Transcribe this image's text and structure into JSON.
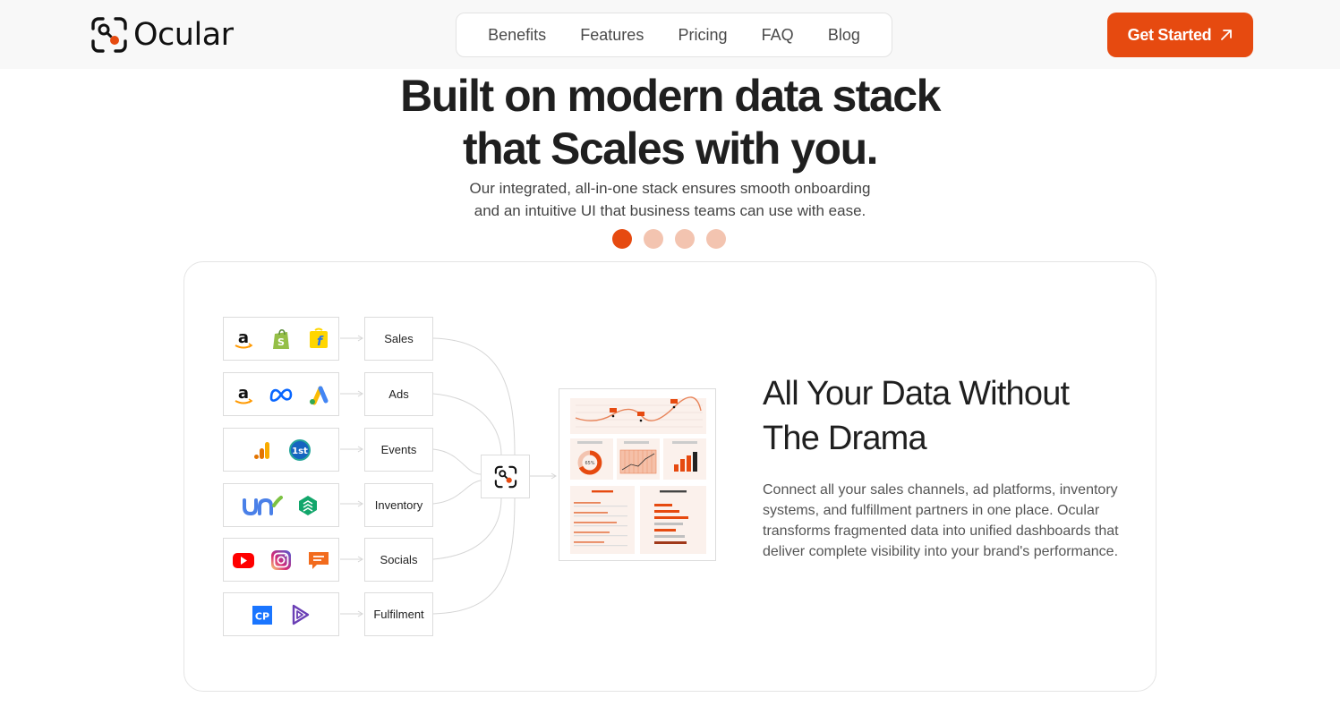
{
  "header": {
    "logo_text": "Ocular",
    "nav": [
      "Benefits",
      "Features",
      "Pricing",
      "FAQ",
      "Blog"
    ],
    "cta_label": "Get Started"
  },
  "hero": {
    "title_line1": "Built on modern data stack",
    "title_line2": "that Scales with you.",
    "subtitle_line1": "Our integrated, all-in-one stack ensures smooth onboarding",
    "subtitle_line2": "and an intuitive UI that business teams can use with ease.",
    "carousel": {
      "total": 4,
      "active_index": 0
    }
  },
  "diagram": {
    "rows": [
      {
        "category": "Sales",
        "icons": [
          "amazon-icon",
          "shopify-icon",
          "flipkart-icon"
        ]
      },
      {
        "category": "Ads",
        "icons": [
          "amazon-icon",
          "meta-icon",
          "google-ads-icon"
        ]
      },
      {
        "category": "Events",
        "icons": [
          "google-analytics-icon",
          "first-party-icon"
        ]
      },
      {
        "category": "Inventory",
        "icons": [
          "unicommerce-icon",
          "easyecom-icon"
        ]
      },
      {
        "category": "Socials",
        "icons": [
          "youtube-icon",
          "instagram-icon",
          "chat-icon"
        ]
      },
      {
        "category": "Fulfilment",
        "icons": [
          "clickpost-icon",
          "shiprocket-icon"
        ]
      }
    ],
    "dashboard": {
      "donut_label": "65%"
    }
  },
  "feature": {
    "title_line1": "All Your Data Without",
    "title_line2": "The Drama",
    "body": "Connect all your sales channels, ad platforms, inventory systems, and fulfillment partners in one place. Ocular transforms fragmented data into unified dashboards that deliver complete visibility into your brand's performance."
  },
  "colors": {
    "accent": "#e64a10",
    "dot_inactive": "#f3c4b0"
  }
}
